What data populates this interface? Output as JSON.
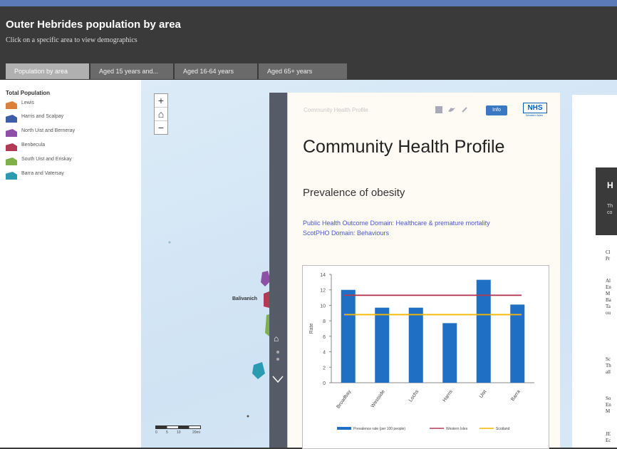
{
  "app": {
    "title": "Outer Hebrides population by area",
    "subtitle": "Click on a specific area to view demographics"
  },
  "tabs": [
    {
      "label": "Population by area"
    },
    {
      "label": "Aged 15 years and..."
    },
    {
      "label": "Aged 16-64 years"
    },
    {
      "label": "Aged 65+ years"
    }
  ],
  "legend": {
    "title": "Total Population",
    "items": [
      {
        "label": "Lewis",
        "color": "#d9813a"
      },
      {
        "label": "Harris and Scalpay",
        "color": "#3c5ea8"
      },
      {
        "label": "North Uist and Berneray",
        "color": "#8e4fa6"
      },
      {
        "label": "Benbecula",
        "color": "#b23a55"
      },
      {
        "label": "South Uist and Eriskay",
        "color": "#7fb04a"
      },
      {
        "label": "Barra and Vatersay",
        "color": "#2a9bb0"
      }
    ]
  },
  "map": {
    "town_label": "Balivanich",
    "scale_labels": [
      "0",
      "5",
      "10",
      "20mi"
    ]
  },
  "panel": {
    "top_title": "Community Health Profile",
    "info_button": "Info",
    "nhs_logo": "NHS",
    "nhs_sub": "Western Isles",
    "title": "Community Health Profile",
    "subtitle": "Prevalence of obesity",
    "link1": "Public Health Outcome Domain: Healthcare & premature mortality",
    "link2": "ScotPHO Domain: Behaviours"
  },
  "chart_data": {
    "type": "bar",
    "categories": [
      "Broadbay",
      "Westside",
      "Lochs",
      "Harris",
      "Uist",
      "Barra"
    ],
    "values": [
      12.0,
      9.7,
      9.7,
      7.7,
      13.3,
      10.1
    ],
    "ylabel": "Rate",
    "ylim": [
      0,
      14
    ],
    "yticks": [
      0,
      2,
      4,
      6,
      8,
      10,
      12,
      14
    ],
    "lines": [
      {
        "name": "Western Isles",
        "value": 11.3,
        "color": "#b23a55"
      },
      {
        "name": "Scotland",
        "value": 8.8,
        "color": "#f5b800"
      }
    ],
    "bar_name": "Prevalence rate (per 100 people)",
    "bar_color": "#1f6fc4",
    "legend_placement": "bottom"
  },
  "right_panel": {
    "heading": "H",
    "text": "Th\nco",
    "blocks": [
      "Cl\nPr",
      "Al\nEn\nM\nBa\nTa\nou",
      "Sc\nTh\nall",
      "So\nEn\nM",
      "JE\nEc"
    ]
  }
}
